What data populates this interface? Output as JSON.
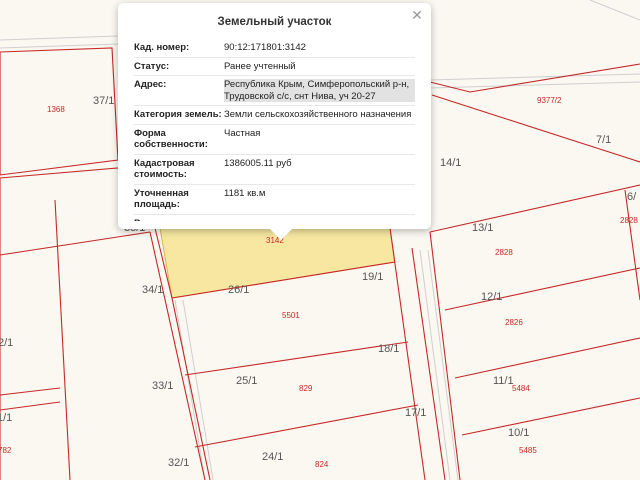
{
  "map": {
    "plot_numbers": [
      "37/1",
      "14/1",
      "7/1",
      "6/",
      "35/1",
      "13/1",
      "34/1",
      "26/1",
      "19/1",
      "12/1",
      "2/1",
      "18/1",
      "33/1",
      "25/1",
      "11/1",
      "1/1",
      "17/1",
      "10/1",
      "32/1",
      "24/1"
    ],
    "cadastral_numbers": [
      "1368",
      "9377/2",
      "2828",
      "2828",
      "3142",
      "5501",
      "2826",
      "829",
      "5484",
      "782",
      "5485",
      "824"
    ],
    "colors": {
      "background": "#fbf8f1",
      "parcel_border": "#c62828",
      "selected_fill": "#f7e7a1",
      "selected_border": "#d4b94a",
      "road_line": "#cccccc"
    }
  },
  "popup": {
    "title": "Земельный участок",
    "close_icon": "close-icon",
    "rows": [
      {
        "key": "Кад. номер:",
        "value": "90:12:171801:3142"
      },
      {
        "key": "Статус:",
        "value": "Ранее учтенный"
      },
      {
        "key": "Адрес:",
        "value": "Республика Крым, Симферопольский р-н, Трудовской с/с, снт Нива, уч 20-27"
      },
      {
        "key": "Категория земель:",
        "value": "Земли сельскохозяйственного назначения"
      },
      {
        "key": "Форма собственности:",
        "value": "Частная"
      },
      {
        "key": "Кадастровая стоимость:",
        "value": "1386005.11 руб"
      },
      {
        "key": "Уточненная площадь:",
        "value": "1181 кв.м"
      },
      {
        "key": "Разрешенное",
        "value": ""
      }
    ]
  }
}
